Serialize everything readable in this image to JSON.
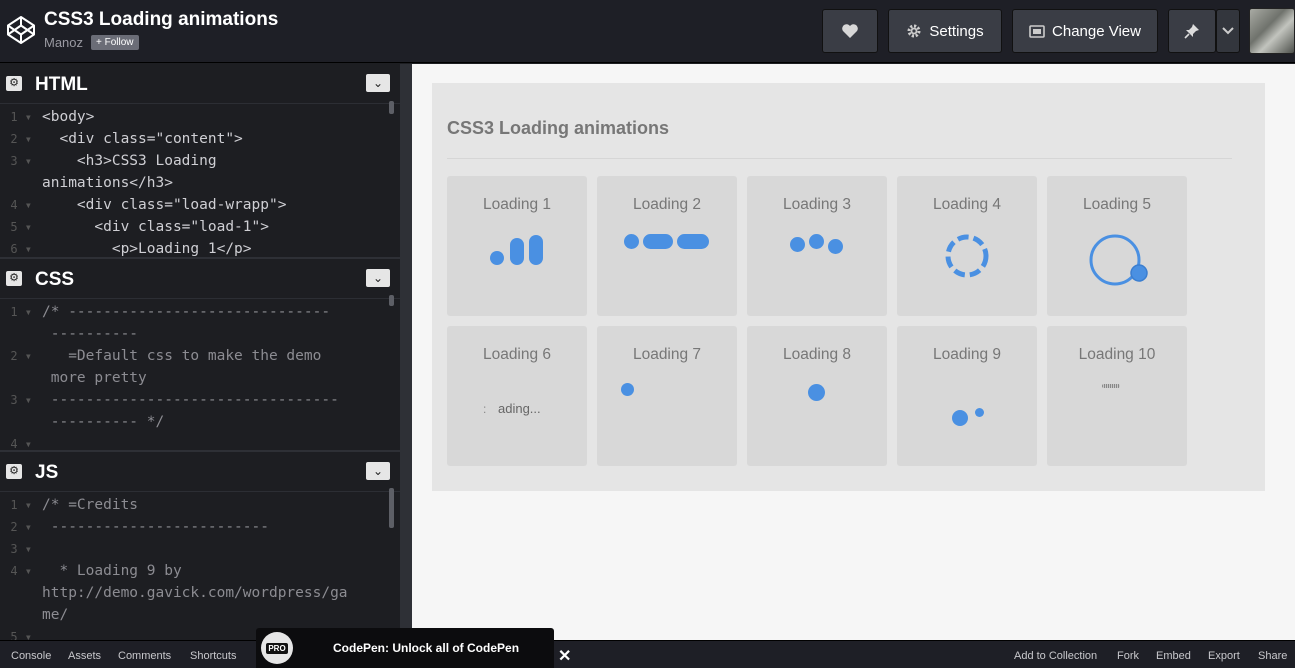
{
  "header": {
    "title": "CSS3 Loading animations",
    "author": "Manoz",
    "follow_label": "+ Follow",
    "settings_label": "Settings",
    "change_view_label": "Change View"
  },
  "panes": {
    "html": {
      "title": "HTML",
      "lines": [
        {
          "n": "1",
          "text": "<body>"
        },
        {
          "n": "2",
          "text": "  <div class=\"content\">"
        },
        {
          "n": "3",
          "text": "    <h3>CSS3 Loading"
        },
        {
          "n": "",
          "text": "animations</h3>"
        },
        {
          "n": "4",
          "text": "    <div class=\"load-wrapp\">"
        },
        {
          "n": "5",
          "text": "      <div class=\"load-1\">"
        },
        {
          "n": "6",
          "text": "        <p>Loading 1</p>"
        }
      ]
    },
    "css": {
      "title": "CSS",
      "lines": [
        {
          "n": "1",
          "text": "/* ------------------------------"
        },
        {
          "n": "",
          "text": " ----------"
        },
        {
          "n": "2",
          "text": "   =Default css to make the demo"
        },
        {
          "n": "",
          "text": " more pretty"
        },
        {
          "n": "3",
          "text": " ---------------------------------"
        },
        {
          "n": "",
          "text": " ---------- */"
        },
        {
          "n": "4",
          "text": ""
        }
      ]
    },
    "js": {
      "title": "JS",
      "lines": [
        {
          "n": "1",
          "text": "/* =Credits"
        },
        {
          "n": "2",
          "text": " -------------------------"
        },
        {
          "n": "3",
          "text": ""
        },
        {
          "n": "4",
          "text": "  * Loading 9 by"
        },
        {
          "n": "",
          "text": "http://demo.gavick.com/wordpress/ga"
        },
        {
          "n": "",
          "text": "me/"
        },
        {
          "n": "5",
          "text": ""
        }
      ]
    }
  },
  "preview": {
    "heading": "CSS3 Loading animations",
    "tiles": [
      {
        "label": "Loading 1"
      },
      {
        "label": "Loading 2"
      },
      {
        "label": "Loading 3"
      },
      {
        "label": "Loading 4"
      },
      {
        "label": "Loading 5"
      },
      {
        "label": "Loading 6",
        "text": "ading..."
      },
      {
        "label": "Loading 7"
      },
      {
        "label": "Loading 8"
      },
      {
        "label": "Loading 9"
      },
      {
        "label": "Loading 10"
      }
    ],
    "accent_color": "#4a90e2"
  },
  "footer": {
    "left": [
      "Console",
      "Assets",
      "Comments",
      "Shortcuts"
    ],
    "right": [
      "Add to Collection",
      "Fork",
      "Embed",
      "Export",
      "Share"
    ],
    "promo_badge": "PRO",
    "promo_text": "CodePen: Unlock all of CodePen",
    "promo_close": "✕"
  }
}
